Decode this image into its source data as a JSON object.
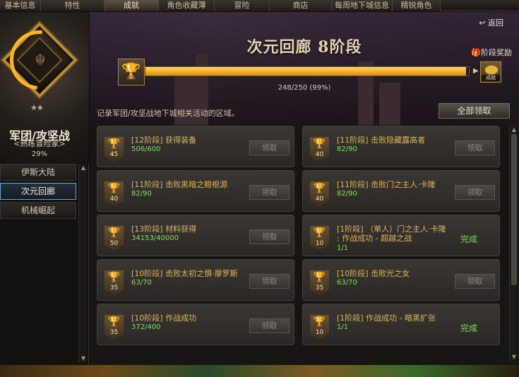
{
  "tabs": [
    {
      "label": "基本信息",
      "width": 58
    },
    {
      "label": "特性",
      "width": 90
    },
    {
      "label": "成就",
      "width": 77,
      "active": true
    },
    {
      "label": "角色收藏薄",
      "width": 79
    },
    {
      "label": "冒险",
      "width": 78
    },
    {
      "label": "商店",
      "width": 88
    },
    {
      "label": "每周地下城信息",
      "width": 86
    },
    {
      "label": "精锐角色",
      "width": 68
    }
  ],
  "left": {
    "stars": "★★",
    "camp_title": "军团/攻坚战",
    "camp_sub": "<熟练冒险家>",
    "camp_pct": "29%",
    "nav": [
      {
        "label": "伊斯大陆"
      },
      {
        "label": "次元回廊",
        "selected": true
      },
      {
        "label": "机械崛起"
      }
    ]
  },
  "header": {
    "back": "返回",
    "title": "次元回廊 8阶段",
    "stage_reward": "阶段奖励",
    "progress_text": "248/250 (99%)",
    "progress_fraction": 0.992,
    "reward_tag": "成就",
    "description": "记录军团/攻坚战地下城相关活动的区域。",
    "claim_all": "全部领取"
  },
  "cards": [
    {
      "title": "[12阶段] 获得装备",
      "count": "506/600",
      "points": "45",
      "claim": "领取"
    },
    {
      "title": "[11阶段] 击败隐藏露高者",
      "count": "82/90",
      "points": "40",
      "claim": "领取"
    },
    {
      "title": "[11阶段] 击败黑暗之眼根源",
      "count": "82/90",
      "points": "40",
      "claim": "领取"
    },
    {
      "title": "[11阶段] 击败门之主人·卡隆",
      "count": "82/90",
      "points": "40",
      "claim": "领取"
    },
    {
      "title": "[13阶段] 材料获得",
      "count": "34153/40000",
      "points": "50",
      "claim": "领取"
    },
    {
      "title": "[1阶段] （单人）门之主人·卡隆 : 作战成功 - 超越之战",
      "count": "1/1",
      "points": "10",
      "done": "完成"
    },
    {
      "title": "[10阶段] 击败太初之惧·摩罗斯",
      "count": "63/70",
      "points": "35",
      "claim": "领取"
    },
    {
      "title": "[10阶段] 击败光之女",
      "count": "63/70",
      "points": "35",
      "claim": "领取"
    },
    {
      "title": "[10阶段] 作战成功",
      "count": "372/400",
      "points": "35",
      "claim": "领取"
    },
    {
      "title": "[1阶段] 作战成功 - 暗黑扩张",
      "count": "1/1",
      "points": "10",
      "done": "完成"
    }
  ]
}
